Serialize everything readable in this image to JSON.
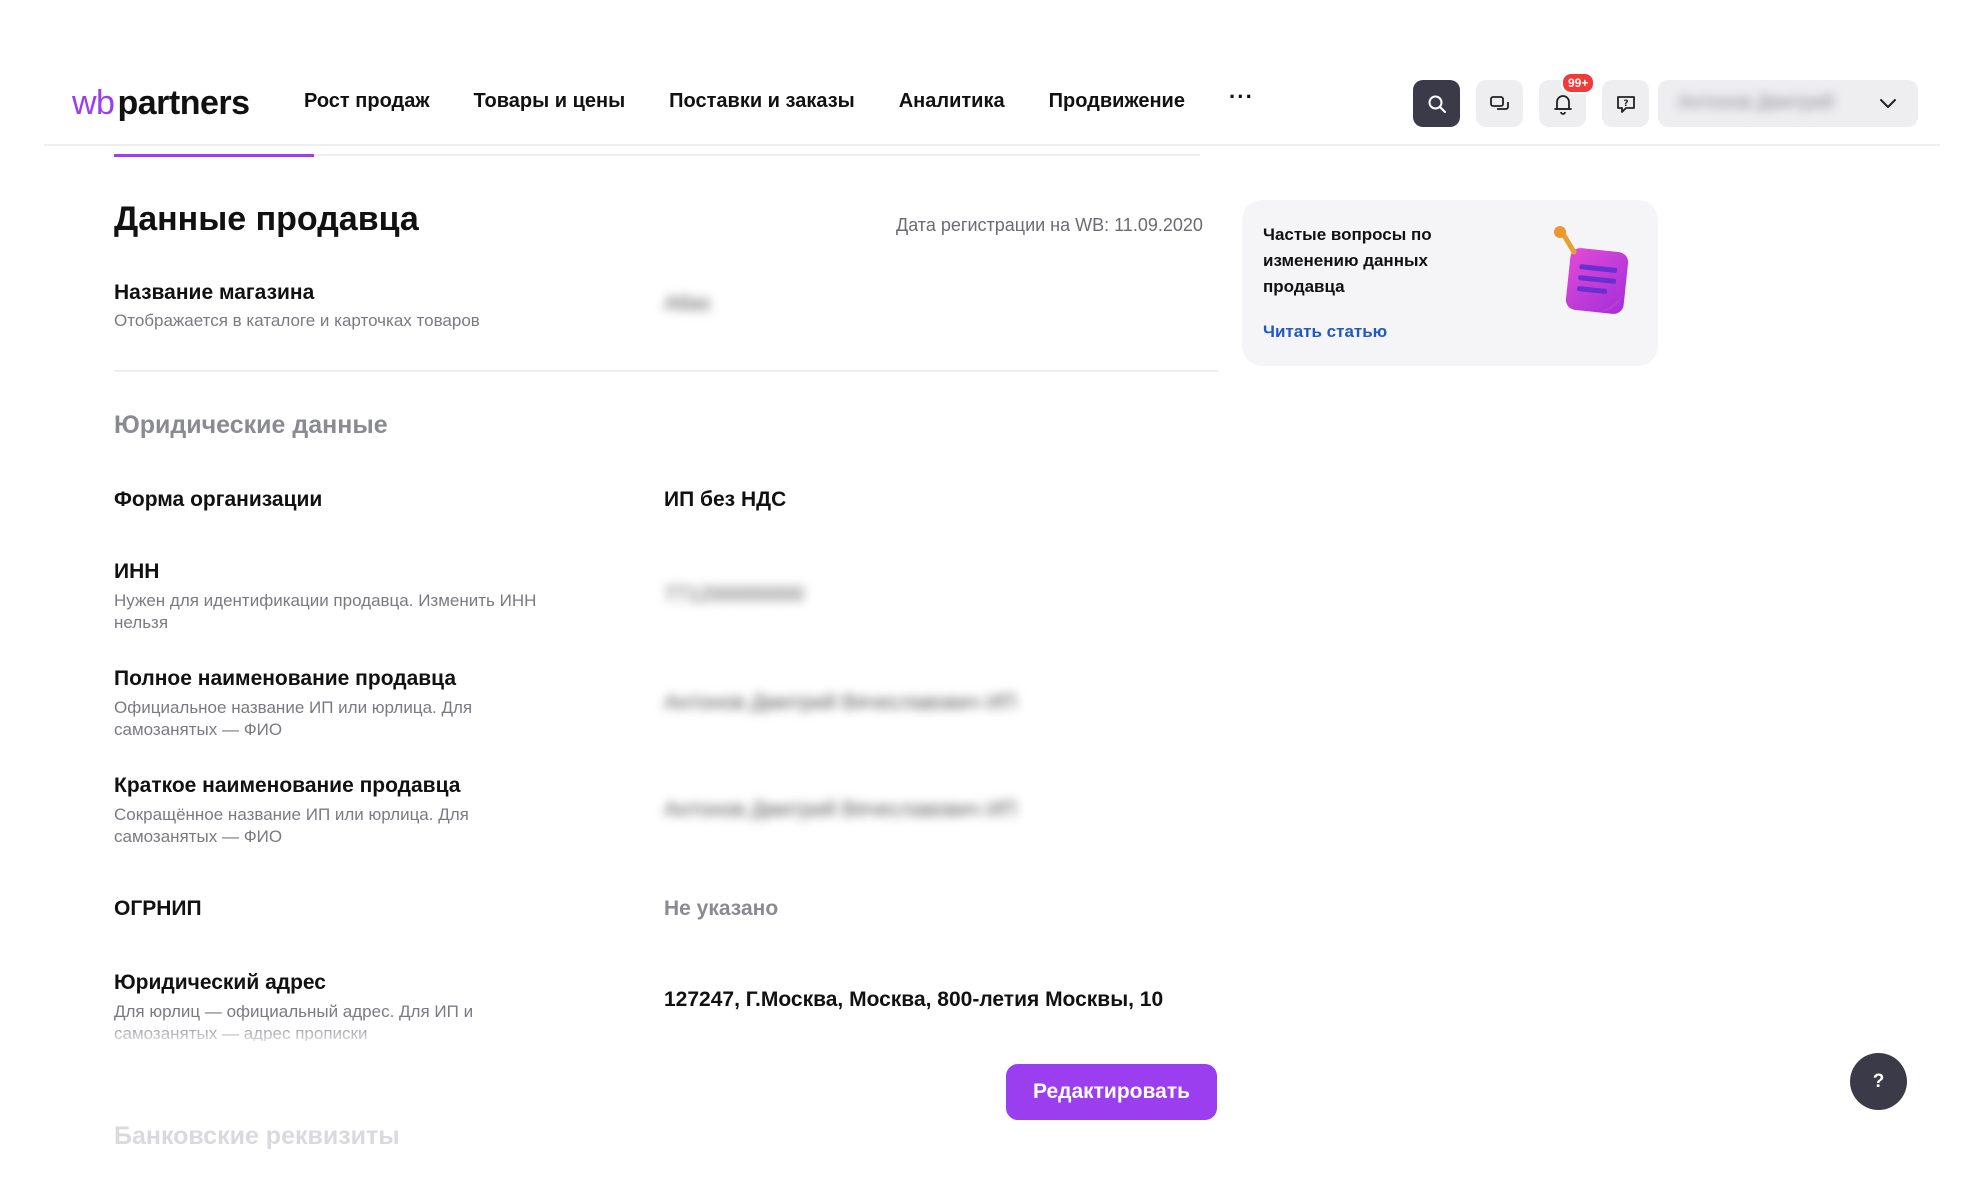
{
  "header": {
    "logo_wb": "wb",
    "logo_partners": "partners",
    "nav": [
      "Рост продаж",
      "Товары и цены",
      "Поставки и заказы",
      "Аналитика",
      "Продвижение"
    ],
    "more": "···",
    "notifications_badge": "99+",
    "user_name": "Антонов Дмитрий"
  },
  "page": {
    "title": "Данные продавца",
    "registration_date": "Дата регистрации на WB: 11.09.2020"
  },
  "store": {
    "label": "Название магазина",
    "hint": "Отображается в каталоге и карточках товаров",
    "value": "Atlas"
  },
  "legal": {
    "section_title": "Юридические данные",
    "org_form_label": "Форма организации",
    "org_form_value": "ИП без НДС",
    "inn_label": "ИНН",
    "inn_hint": "Нужен для идентификации продавца. Изменить ИНН нельзя",
    "inn_value": "771200000000",
    "full_name_label": "Полное наименование продавца",
    "full_name_hint": "Официальное название ИП или юрлица. Для самозанятых — ФИО",
    "full_name_value": "Антонов Дмитрий Вячеславович ИП",
    "short_name_label": "Краткое наименование продавца",
    "short_name_hint": "Сокращённое название ИП или юрлица. Для самозанятых — ФИО",
    "short_name_value": "Антонов Дмитрий Вячеславович ИП",
    "ogrnip_label": "ОГРНИП",
    "ogrnip_value": "Не указано",
    "address_label": "Юридический адрес",
    "address_hint": "Для юрлиц — официальный адрес. Для ИП и самозанятых — адрес прописки",
    "address_value": "127247, Г.Москва, Москва, 800-летия Москвы, 10"
  },
  "bank": {
    "section_title": "Банковские реквизиты"
  },
  "actions": {
    "edit": "Редактировать"
  },
  "faq": {
    "text": "Частые вопросы по изменению данных продавца",
    "link": "Читать статью"
  },
  "help": {
    "label": "?"
  },
  "colors": {
    "accent": "#9a3ef0",
    "link": "#2158c6",
    "dark": "#3b3a48",
    "badge": "#f23a3a"
  }
}
